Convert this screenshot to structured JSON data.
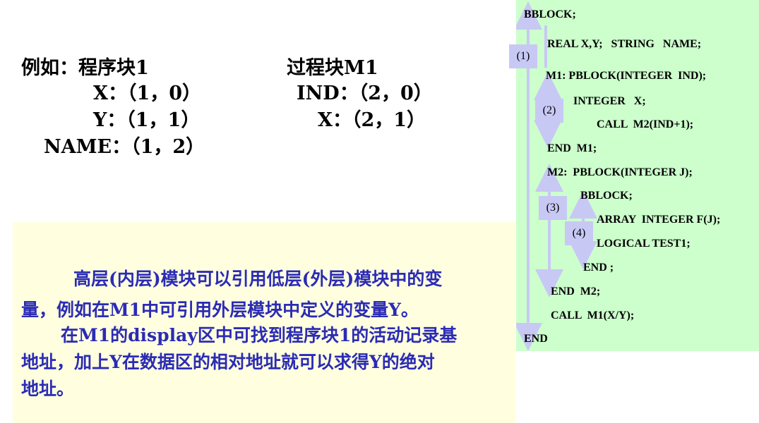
{
  "example": {
    "block1_title": "例如：程序块1",
    "block1_rows": [
      "X：（1，0）",
      "Y：（1，1）",
      "NAME：（1，2）"
    ],
    "proc_title": "过程块M1",
    "proc_rows": [
      "IND：（2，0）",
      "X：（2，1）"
    ]
  },
  "note": {
    "lines": [
      "高层(内层)模块可以引用低层(外层)模块中的变",
      "量，例如在M1中可引用外层模块中定义的变量Y。",
      "在M1的display区中可找到程序块1的活动记录基",
      "地址，加上Y在数据区的相对地址就可以求得Y的绝对",
      "地址。"
    ]
  },
  "code": {
    "lines": [
      "BBLOCK;",
      "REAL X,Y;   STRING   NAME;",
      "M1: PBLOCK(INTEGER  IND);",
      "INTEGER   X;",
      "CALL  M2(IND+1);",
      "END  M1;",
      "M2:  PBLOCK(INTEGER J);",
      "BBLOCK;",
      "ARRAY  INTEGER F(J);",
      "LOGICAL TEST1;",
      "END ;",
      "END  M2;",
      "CALL  M1(X/Y);",
      "END"
    ],
    "levels": [
      "(1)",
      "(2)",
      "(3)",
      "(4)"
    ],
    "colors": {
      "panel": "#ccffcc",
      "level_box": "#c8c8f5",
      "arrow": "#c8c8f5",
      "note_text": "#2b2bb5",
      "note_bg": "#ffffe0"
    }
  }
}
